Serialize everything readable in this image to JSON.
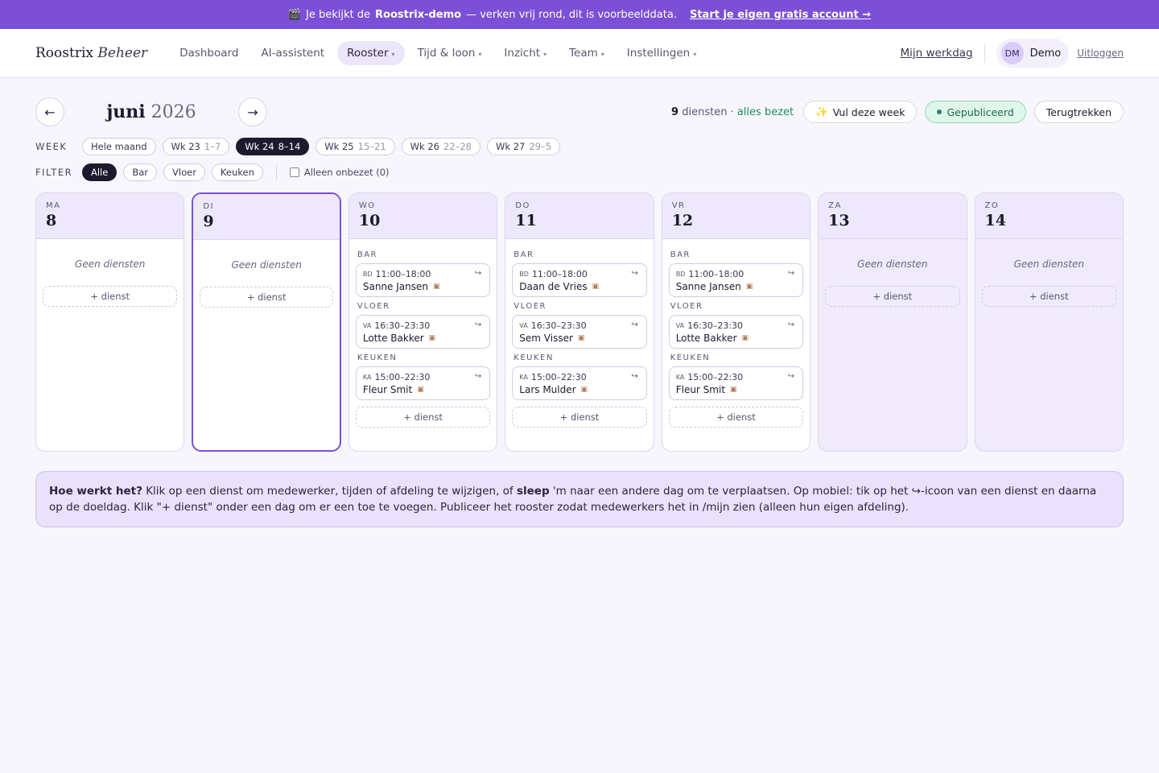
{
  "banner": {
    "icon": "clapperboard-icon",
    "pre": "Je bekijkt de",
    "brand": "Roostrix-demo",
    "post": "— verken vrij rond, dit is voorbeelddata.",
    "cta": "Start je eigen gratis account →"
  },
  "nav": {
    "brand_main": "Roostrix",
    "brand_sub": "Beheer",
    "items": [
      {
        "label": "Dashboard",
        "caret": ""
      },
      {
        "label": "AI-assistent",
        "caret": ""
      },
      {
        "label": "Rooster",
        "caret": "▾"
      },
      {
        "label": "Tijd & loon",
        "caret": "▾"
      },
      {
        "label": "Inzicht",
        "caret": "▾"
      },
      {
        "label": "Team",
        "caret": "▾"
      },
      {
        "label": "Instellingen",
        "caret": "▾"
      }
    ],
    "mijn_werkdag": "Mijn werkdag",
    "avatar": "DM",
    "user": "Demo",
    "logout": "Uitloggen"
  },
  "toolbar": {
    "prev": "←",
    "next": "→",
    "month": "juni",
    "year": "2026",
    "stat_count": "9",
    "stat_label": "diensten ·",
    "stat_status": "alles bezet",
    "fill_icon": "sparkle-icon",
    "fill_label": "Vul deze week",
    "published": "Gepubliceerd",
    "withdraw": "Terugtrekken"
  },
  "week": {
    "label": "WEEK",
    "chips": [
      {
        "main": "Hele maand",
        "sub": ""
      },
      {
        "main": "Wk 23",
        "sub": "1–7"
      },
      {
        "main": "Wk 24",
        "sub": "8–14"
      },
      {
        "main": "Wk 25",
        "sub": "15–21"
      },
      {
        "main": "Wk 26",
        "sub": "22–28"
      },
      {
        "main": "Wk 27",
        "sub": "29–5"
      }
    ]
  },
  "filter": {
    "label": "FILTER",
    "chips": [
      "Alle",
      "Bar",
      "Vloer",
      "Keuken"
    ],
    "unassigned": "Alleen onbezet (0)"
  },
  "days": [
    {
      "abbr": "MA",
      "num": "8",
      "empty": "Geen diensten",
      "add": "+ dienst"
    },
    {
      "abbr": "DI",
      "num": "9",
      "empty": "Geen diensten",
      "add": "+ dienst"
    },
    {
      "abbr": "WO",
      "num": "10",
      "add": "+ dienst",
      "shifts": [
        {
          "dept": "BAR",
          "code": "BD",
          "time": "11:00–18:00",
          "name": "Sanne Jansen"
        },
        {
          "dept": "VLOER",
          "code": "VA",
          "time": "16:30–23:30",
          "name": "Lotte Bakker"
        },
        {
          "dept": "KEUKEN",
          "code": "KA",
          "time": "15:00–22:30",
          "name": "Fleur Smit"
        }
      ]
    },
    {
      "abbr": "DO",
      "num": "11",
      "add": "+ dienst",
      "shifts": [
        {
          "dept": "BAR",
          "code": "BD",
          "time": "11:00–18:00",
          "name": "Daan de Vries"
        },
        {
          "dept": "VLOER",
          "code": "VA",
          "time": "16:30–23:30",
          "name": "Sem Visser"
        },
        {
          "dept": "KEUKEN",
          "code": "KA",
          "time": "15:00–22:30",
          "name": "Lars Mulder"
        }
      ]
    },
    {
      "abbr": "VR",
      "num": "12",
      "add": "+ dienst",
      "shifts": [
        {
          "dept": "BAR",
          "code": "BD",
          "time": "11:00–18:00",
          "name": "Sanne Jansen"
        },
        {
          "dept": "VLOER",
          "code": "VA",
          "time": "16:30–23:30",
          "name": "Lotte Bakker"
        },
        {
          "dept": "KEUKEN",
          "code": "KA",
          "time": "15:00–22:30",
          "name": "Fleur Smit"
        }
      ]
    },
    {
      "abbr": "ZA",
      "num": "13",
      "empty": "Geen diensten",
      "add": "+ dienst"
    },
    {
      "abbr": "ZO",
      "num": "14",
      "empty": "Geen diensten",
      "add": "+ dienst"
    }
  ],
  "help": {
    "title": "Hoe werkt het?",
    "t1": "Klik op een dienst om medewerker, tijden of afdeling te wijzigen, of",
    "bold": "sleep",
    "t2": "'m naar een andere dag om te verplaatsen. Op mobiel: tik op het",
    "icon": "↪",
    "t3": "-icoon van een dienst en daarna op de doeldag. Klik \"+ dienst\" onder een dag om er een toe te voegen. Publiceer het rooster zodat medewerkers het in /mijn zien (alleen hun eigen afdeling)."
  }
}
